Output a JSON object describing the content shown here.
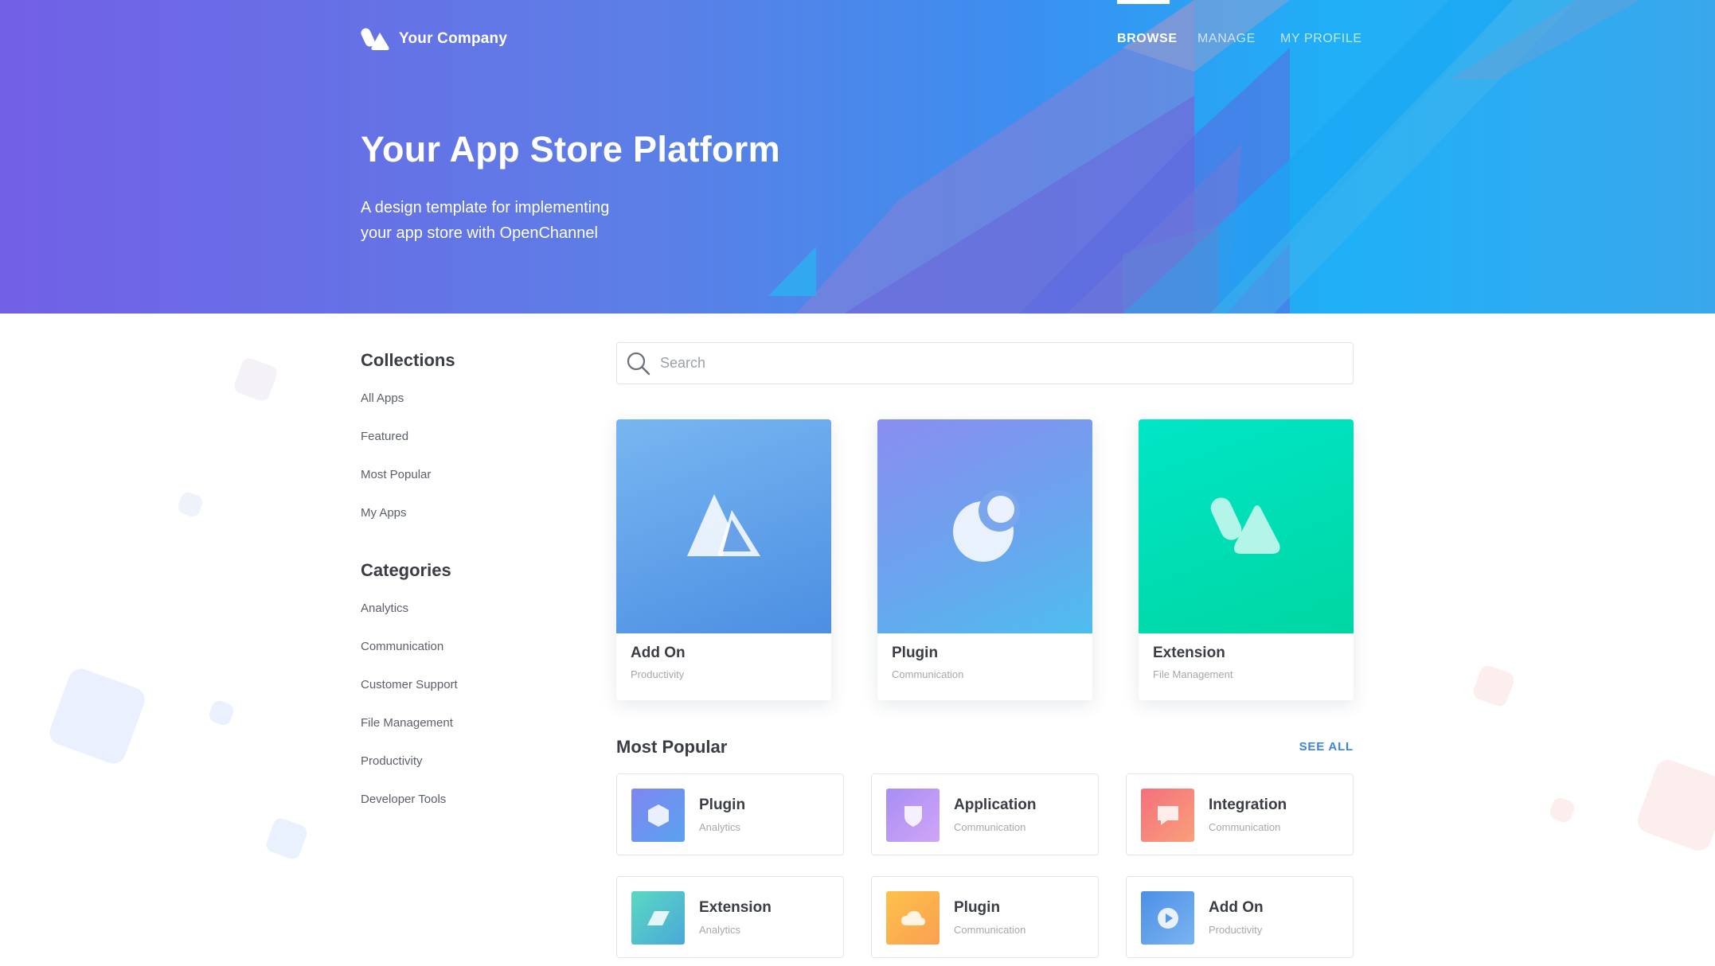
{
  "brand": {
    "name": "Your Company"
  },
  "nav": {
    "items": [
      {
        "label": "BROWSE"
      },
      {
        "label": "MANAGE"
      },
      {
        "label": "MY PROFILE"
      }
    ]
  },
  "hero": {
    "title": "Your App Store Platform",
    "subtitle_line1": "A design template for implementing",
    "subtitle_line2": "your app store with OpenChannel"
  },
  "sidebar": {
    "collections_heading": "Collections",
    "collections": [
      {
        "label": "All Apps"
      },
      {
        "label": "Featured"
      },
      {
        "label": "Most Popular"
      },
      {
        "label": "My Apps"
      }
    ],
    "categories_heading": "Categories",
    "categories": [
      {
        "label": "Analytics"
      },
      {
        "label": "Communication"
      },
      {
        "label": "Customer Support"
      },
      {
        "label": "File Management"
      },
      {
        "label": "Productivity"
      },
      {
        "label": "Developer Tools"
      }
    ]
  },
  "search": {
    "placeholder": "Search"
  },
  "featured": [
    {
      "name": "Add On",
      "category": "Productivity",
      "icon": "mountain-icon"
    },
    {
      "name": "Plugin",
      "category": "Communication",
      "icon": "moon-icon"
    },
    {
      "name": "Extension",
      "category": "File Management",
      "icon": "shapes-icon"
    }
  ],
  "popular": {
    "title": "Most Popular",
    "see_all": "SEE ALL",
    "items": [
      {
        "name": "Plugin",
        "category": "Analytics",
        "icon": "hexagon-icon",
        "color": "#6f8ef0"
      },
      {
        "name": "Application",
        "category": "Communication",
        "icon": "shield-icon",
        "color": "#b99af5"
      },
      {
        "name": "Integration",
        "category": "Communication",
        "icon": "chat-icon",
        "color": "#f7867c"
      },
      {
        "name": "Extension",
        "category": "Analytics",
        "icon": "parallelogram-icon",
        "color": "#4fcfbf"
      },
      {
        "name": "Plugin",
        "category": "Communication",
        "icon": "cloud-icon",
        "color": "#fbb74f"
      },
      {
        "name": "Add On",
        "category": "Productivity",
        "icon": "play-icon",
        "color": "#5f9ef0"
      }
    ]
  },
  "colors": {
    "accent": "#3d82e3",
    "hero_start": "#7260e6",
    "hero_end": "#1fb0f7"
  }
}
